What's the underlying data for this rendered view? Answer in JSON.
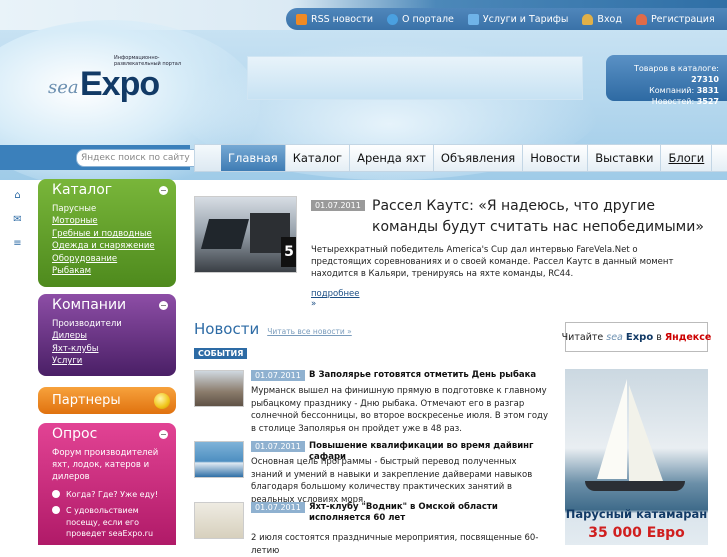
{
  "topnav": [
    {
      "label": "RSS новости",
      "icon": "rss-icon",
      "color": "#f08a24"
    },
    {
      "label": "О портале",
      "icon": "globe-icon",
      "color": "#4aa0e0"
    },
    {
      "label": "Услуги и Тарифы",
      "icon": "monitor-icon",
      "color": "#6fb3e8"
    },
    {
      "label": "Вход",
      "icon": "user-icon",
      "color": "#e0b048"
    },
    {
      "label": "Регистрация",
      "icon": "user-add-icon",
      "color": "#e06b48"
    }
  ],
  "logo": {
    "sea": "sea",
    "expo": "Expo",
    "tagline": "Информационно-развлекательный портал"
  },
  "stats": {
    "catalog_label": "Товаров в каталоге:",
    "catalog_value": "27310",
    "companies_label": "Компаний:",
    "companies_value": "3831",
    "news_label": "Новостей:",
    "news_value": "3527"
  },
  "search": {
    "placeholder": "Яндекс поиск по сайту"
  },
  "mainnav": [
    "Главная",
    "Каталог",
    "Аренда яхт",
    "Объявления",
    "Новости",
    "Выставки",
    "Блоги"
  ],
  "catalog": {
    "title": "Каталог",
    "items": [
      "Парусные",
      "Моторные",
      "Гребные и подводные",
      "Одежда и снаряжение",
      "Оборудование",
      "Рыбакам"
    ]
  },
  "companies": {
    "title": "Компании",
    "items": [
      "Производители",
      "Дилеры",
      "Яхт-клубы",
      "Услуги"
    ]
  },
  "partners": {
    "title": "Партнеры"
  },
  "poll": {
    "title": "Опрос",
    "question": "Форум производителей яхт, лодок, катеров и дилеров",
    "option1": "Когда? Где? Уже еду!",
    "option2": "С удовольствием посещу, если его проведет seaExpo.ru"
  },
  "featured": {
    "date": "01.07.2011",
    "title": "Рассел Каутс: «Я надеюсь, что другие команды будут считать нас непобедимыми»",
    "text": "Четырехкратный победитель America's Cup дал интервью FareVela.Net о предстоящих соревнованиях и о своей команде. Рассел Каутс в данный момент находится в Кальяри, тренируясь на яхте команды, RC44.",
    "more": "подробнее",
    "more_arrow": "»",
    "image_label": "5"
  },
  "news": {
    "title": "Новости",
    "all_link": "Читать все новости »",
    "section": "СОБЫТИЯ",
    "items": [
      {
        "date": "01.07.2011",
        "title": "В Заполярье готовятся отметить День рыбака",
        "text": "Мурманск вышел на финишную прямую в подготовке к главному рыбацкому празднику - Дню рыбака. Отмечают его в разгар солнечной бессонницы, во второе воскресенье июля. В этом году в столице Заполярья он пройдет уже в 48 раз."
      },
      {
        "date": "01.07.2011",
        "title": "Повышение квалификации во время дайвинг сафари",
        "text": "Основная цель программы - быстрый перевод полученных знаний и умений в навыки и закрепление дайверами навыков благодаря большому количеству практических занятий в реальных условиях моря."
      },
      {
        "date": "01.07.2011",
        "title": "Яхт-клубу \"Водник\" в Омской области исполняется 60 лет",
        "text": "2 июля состоятся праздничные мероприятия, посвященные 60-летию"
      }
    ]
  },
  "yandex_banner": {
    "read": "Читайте",
    "sea": "sea",
    "expo": "Expo",
    "in": "в",
    "yandex": "Яндексе"
  },
  "ad": {
    "line1": "Парусный катамаран",
    "line2": "35 000 Евро"
  }
}
